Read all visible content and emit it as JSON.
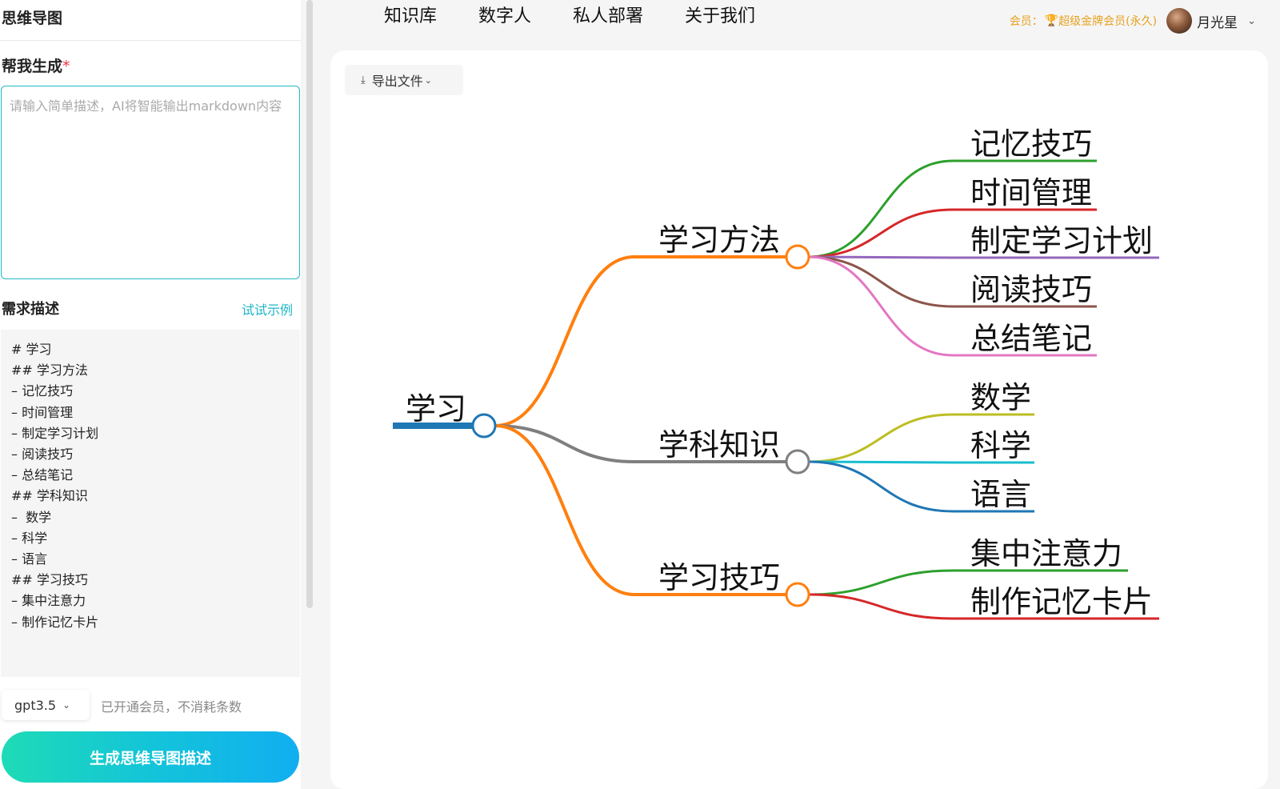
{
  "sidebar": {
    "title": "思维导图",
    "generate_label": "帮我生成",
    "required_mark": "*",
    "prompt_placeholder": "请输入简单描述，AI将智能输出markdown内容",
    "requirement_label": "需求描述",
    "example_link": "试试示例",
    "markdown_lines": [
      "# 学习",
      "## 学习方法",
      "– 记忆技巧",
      "– 时间管理",
      "– 制定学习计划",
      "– 阅读技巧",
      "– 总结笔记",
      "## 学科知识",
      "–  数学",
      "– 科学",
      "– 语言",
      "## 学习技巧",
      "– 集中注意力",
      "– 制作记忆卡片"
    ],
    "model": "gpt3.5",
    "quota_note": "已开通会员，不消耗条数",
    "generate_button": "生成思维导图描述"
  },
  "nav": {
    "items": [
      "知识库",
      "数字人",
      "私人部署",
      "关于我们"
    ]
  },
  "user": {
    "member_label": "会员：",
    "member_level": "超级金牌会员(永久)",
    "name": "月光星",
    "medal_icon": "medal-icon",
    "colors": {
      "member": "#e7a21f"
    }
  },
  "toolbar": {
    "export_label": "导出文件"
  },
  "mindmap": {
    "root": {
      "label": "学习",
      "color": "#1f77b4"
    },
    "branches": [
      {
        "label": "学习方法",
        "color": "#ff7f0e",
        "children": [
          {
            "label": "记忆技巧",
            "color": "#2ca02c"
          },
          {
            "label": "时间管理",
            "color": "#d62728"
          },
          {
            "label": "制定学习计划",
            "color": "#9467bd"
          },
          {
            "label": "阅读技巧",
            "color": "#8c564b"
          },
          {
            "label": "总结笔记",
            "color": "#e377c2"
          }
        ]
      },
      {
        "label": "学科知识",
        "color": "#7f7f7f",
        "children": [
          {
            "label": "数学",
            "color": "#bcbd22"
          },
          {
            "label": "科学",
            "color": "#17becf"
          },
          {
            "label": "语言",
            "color": "#1f77b4"
          }
        ]
      },
      {
        "label": "学习技巧",
        "color": "#ff7f0e",
        "children": [
          {
            "label": "集中注意力",
            "color": "#2ca02c"
          },
          {
            "label": "制作记忆卡片",
            "color": "#d62728"
          }
        ]
      }
    ]
  }
}
